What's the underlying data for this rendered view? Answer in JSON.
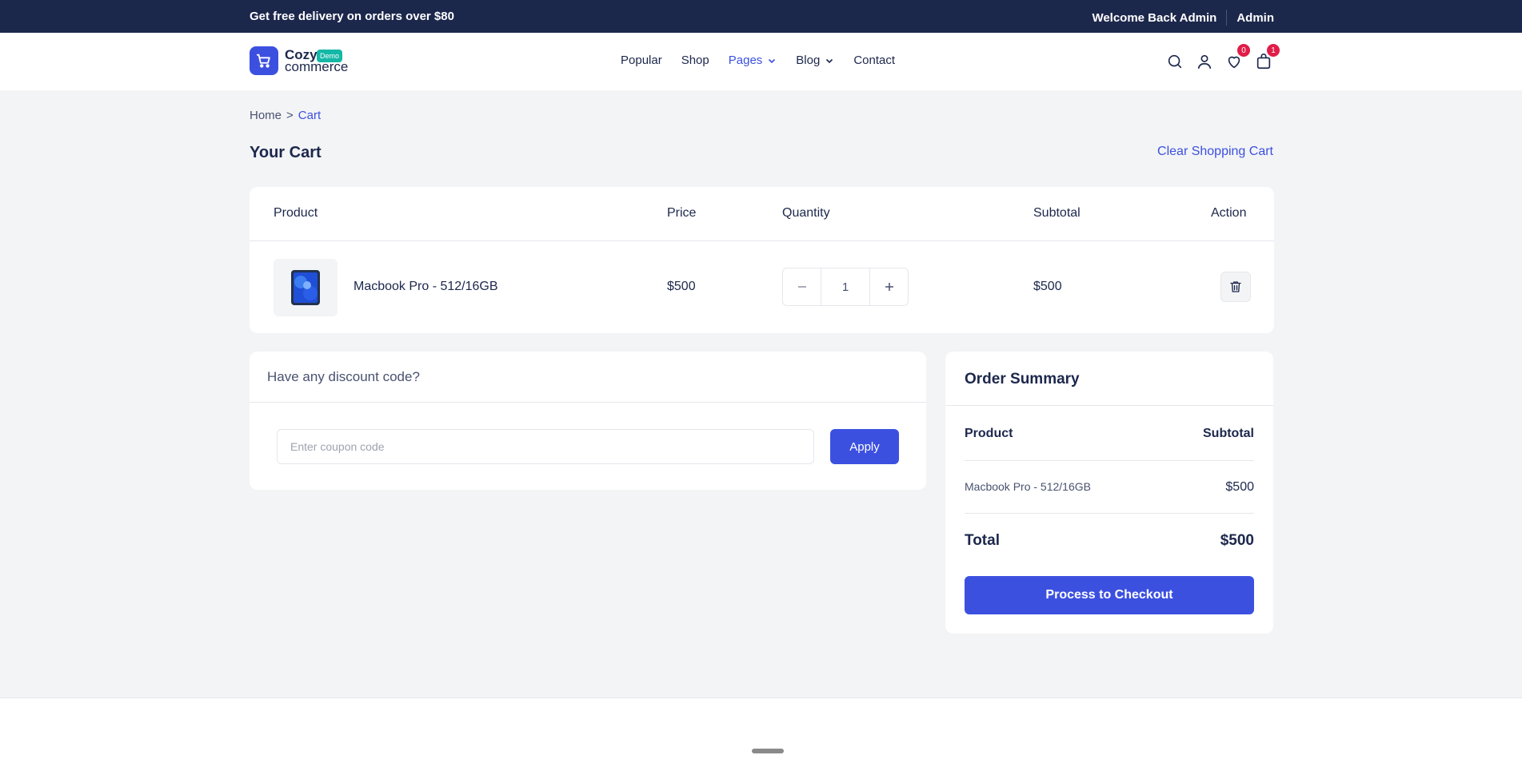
{
  "topbar": {
    "promo": "Get free delivery on orders over $80",
    "welcome": "Welcome Back Admin",
    "account": "Admin"
  },
  "logo": {
    "line1": "Cozy",
    "line2": "commerce",
    "demo_badge": "Demo"
  },
  "nav": {
    "items": [
      {
        "label": "Popular"
      },
      {
        "label": "Shop"
      },
      {
        "label": "Pages"
      },
      {
        "label": "Blog"
      },
      {
        "label": "Contact"
      }
    ]
  },
  "header_icons": {
    "wishlist_count": "0",
    "cart_count": "1"
  },
  "breadcrumb": {
    "home": "Home",
    "separator": ">",
    "current": "Cart"
  },
  "page": {
    "title": "Your Cart",
    "clear_cart": "Clear Shopping Cart"
  },
  "cart_table": {
    "columns": [
      "Product",
      "Price",
      "Quantity",
      "Subtotal",
      "Action"
    ],
    "rows": [
      {
        "product": "Macbook Pro - 512/16GB",
        "price": "$500",
        "quantity": "1",
        "subtotal": "$500"
      }
    ]
  },
  "discount": {
    "heading": "Have any discount code?",
    "placeholder": "Enter coupon code",
    "apply_label": "Apply"
  },
  "summary": {
    "heading": "Order Summary",
    "col_product": "Product",
    "col_subtotal": "Subtotal",
    "item_name": "Macbook Pro - 512/16GB",
    "item_price": "$500",
    "total_label": "Total",
    "total_value": "$500",
    "checkout_label": "Process to Checkout"
  },
  "colors": {
    "primary": "#3c50e0",
    "dark": "#1c274c",
    "badge": "#e11d48",
    "demo": "#14b8a6"
  }
}
